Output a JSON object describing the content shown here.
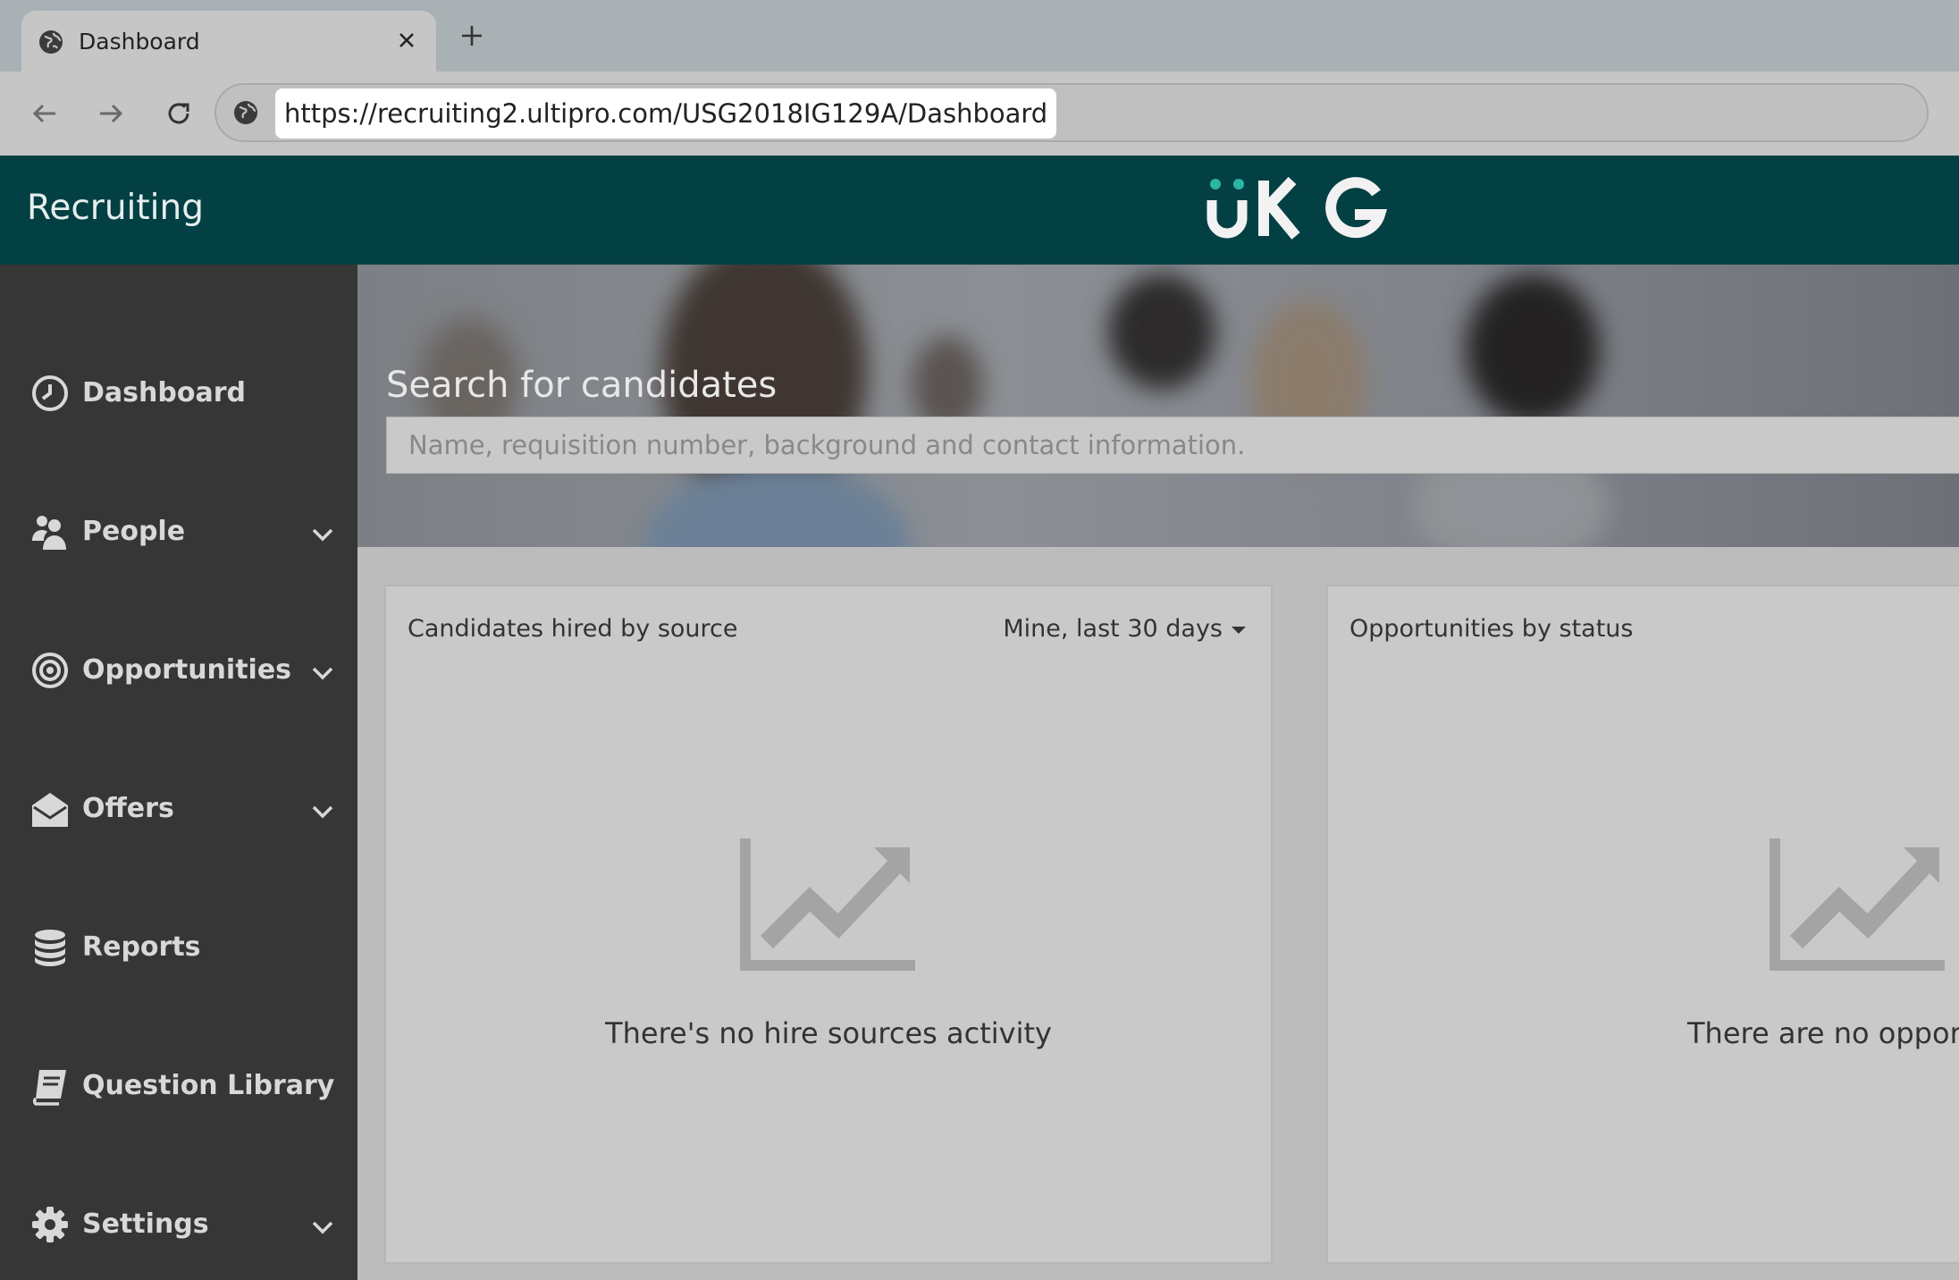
{
  "browser": {
    "tab": {
      "title": "Dashboard",
      "icon": "globe-icon",
      "close_icon": "close-icon"
    },
    "new_tab_icon": "plus-icon",
    "nav": {
      "back_icon": "arrow-left-icon",
      "forward_icon": "arrow-right-icon",
      "reload_icon": "reload-icon"
    },
    "address_bar": {
      "icon": "site-info-icon",
      "url": "https://recruiting2.ultipro.com/USG2018IG129A/Dashboard"
    }
  },
  "header": {
    "app_title": "Recruiting",
    "logo": {
      "text": "UKG",
      "dot_color": "#2bb5a6",
      "text_color": "#f2f2f2"
    },
    "background": "#034044"
  },
  "sidebar": {
    "items": [
      {
        "label": "Dashboard",
        "icon": "clock-icon",
        "has_submenu": false
      },
      {
        "label": "People",
        "icon": "people-icon",
        "has_submenu": true
      },
      {
        "label": "Opportunities",
        "icon": "target-icon",
        "has_submenu": true
      },
      {
        "label": "Offers",
        "icon": "envelope-open-icon",
        "has_submenu": true
      },
      {
        "label": "Reports",
        "icon": "database-icon",
        "has_submenu": false
      },
      {
        "label": "Question Library",
        "icon": "book-icon",
        "has_submenu": false
      },
      {
        "label": "Settings",
        "icon": "gear-icon",
        "has_submenu": true
      }
    ]
  },
  "hero": {
    "title": "Search for candidates",
    "search_placeholder": "Name, requisition number, background and contact information."
  },
  "cards": [
    {
      "title": "Candidates hired by source",
      "filter": "Mine, last 30 days",
      "empty_icon": "line-chart-icon",
      "empty_text": "There's no hire sources activity"
    },
    {
      "title": "Opportunities by status",
      "empty_icon": "line-chart-icon",
      "empty_text": "There are no opportu"
    }
  ]
}
